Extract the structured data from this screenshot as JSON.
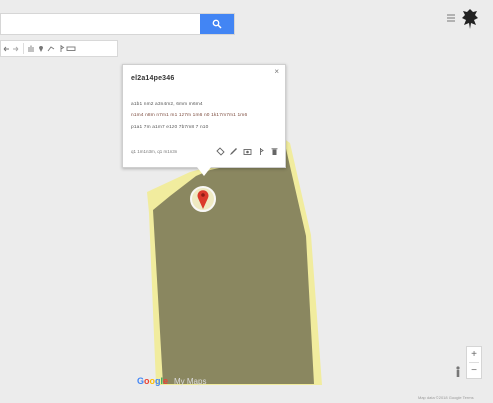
{
  "search": {
    "value": "",
    "placeholder": ""
  },
  "toolbar": {
    "tools": [
      "undo-icon",
      "redo-icon",
      "hand-icon",
      "marker-icon",
      "line-icon",
      "direction-icon",
      "ruler-icon"
    ]
  },
  "popup": {
    "title": "el2a14pe346",
    "close_label": "×",
    "lines": [
      "a1b1 nm2 a3n4m2, 6mm m6m4",
      "n1m4 n8m n7m1 m1 1z7m 1m6 n0 1k17m7m1 1m6",
      "p1a1 7m a1m7 e1z0 7b7m8 7 n10"
    ],
    "footer": "q1 1m1n3m, q1 m1n3n"
  },
  "map": {
    "polygon_fill": "#8a8760",
    "polygon_border": "#f1ec9e",
    "marker_color": "#db3a2b"
  },
  "branding": {
    "google": "Google",
    "my_maps": "My Maps"
  },
  "zoom": {
    "in_label": "+",
    "out_label": "−"
  },
  "attribution": "Map data ©2018 Google  Terms"
}
